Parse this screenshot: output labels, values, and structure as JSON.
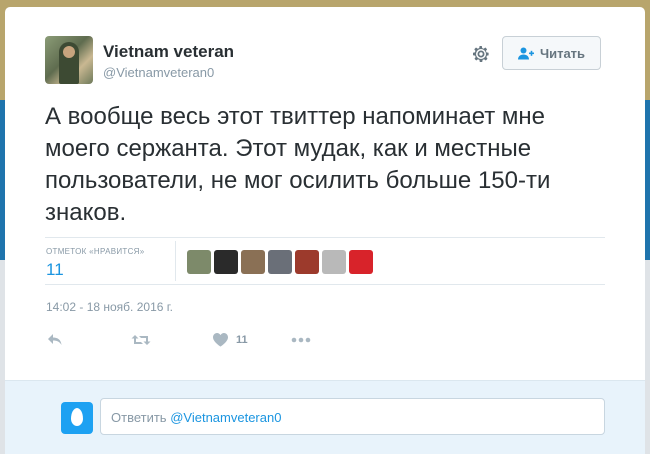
{
  "tweet": {
    "author_name": "Vietnam veteran",
    "author_handle": "@Vietnamveteran0",
    "follow_label": "Читать",
    "text": "А вообще весь этот твиттер напоминает мне моего сержанта. Этот мудак, как и местные пользователи, не мог осилить больше 150-ти знаков.",
    "likes_label": "ОТМЕТОК «НРАВИТСЯ»",
    "likes_count": "11",
    "timestamp": "14:02 - 18 нояб. 2016 г.",
    "like_action_count": "11",
    "likers": [
      {
        "color": "#7d8a6a"
      },
      {
        "color": "#2a2a2a"
      },
      {
        "color": "#8a7055"
      },
      {
        "color": "#6a6f78"
      },
      {
        "color": "#9c3a2c"
      },
      {
        "color": "#b9b9b9"
      },
      {
        "color": "#d8232a"
      }
    ]
  },
  "reply": {
    "prefix": "Ответить",
    "mention": "@Vietnamveteran0"
  },
  "colors": {
    "link": "#1b95e0",
    "muted": "#8899a6",
    "text": "#292f33"
  }
}
